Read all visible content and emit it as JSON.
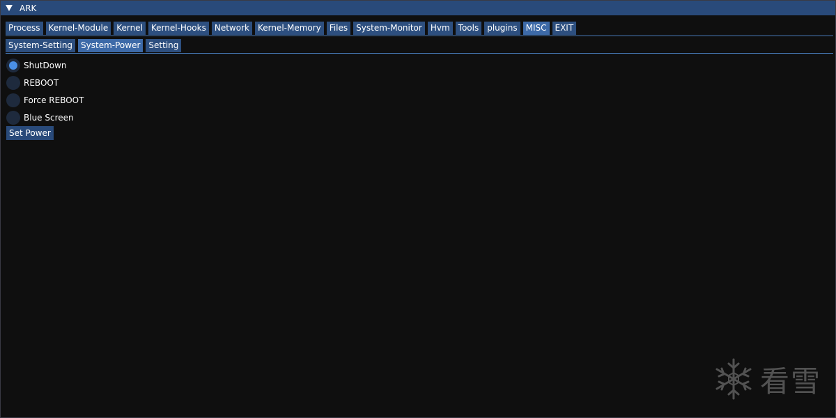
{
  "window": {
    "title": "ARK"
  },
  "main_tabs": [
    {
      "label": "Process",
      "active": false
    },
    {
      "label": "Kernel-Module",
      "active": false
    },
    {
      "label": "Kernel",
      "active": false
    },
    {
      "label": "Kernel-Hooks",
      "active": false
    },
    {
      "label": "Network",
      "active": false
    },
    {
      "label": "Kernel-Memory",
      "active": false
    },
    {
      "label": "Files",
      "active": false
    },
    {
      "label": "System-Monitor",
      "active": false
    },
    {
      "label": "Hvm",
      "active": false
    },
    {
      "label": "Tools",
      "active": false
    },
    {
      "label": "plugins",
      "active": false
    },
    {
      "label": "MISC",
      "active": true
    },
    {
      "label": "EXIT",
      "active": false
    }
  ],
  "sub_tabs": [
    {
      "label": "System-Setting",
      "active": false
    },
    {
      "label": "System-Power",
      "active": true
    },
    {
      "label": "Setting",
      "active": false
    }
  ],
  "power_options": [
    {
      "label": "ShutDown",
      "selected": true
    },
    {
      "label": "REBOOT",
      "selected": false
    },
    {
      "label": "Force REBOOT",
      "selected": false
    },
    {
      "label": "Blue Screen",
      "selected": false
    }
  ],
  "set_power_label": "Set Power",
  "watermark": {
    "text": "看雪",
    "icon": "snowflake-icon"
  },
  "colors": {
    "accent": "#294a7a",
    "tab": "#2d4f7f",
    "tab_active": "#3d6aa8",
    "radio_selected": "#4a90e8",
    "background": "#0f0f0f"
  }
}
